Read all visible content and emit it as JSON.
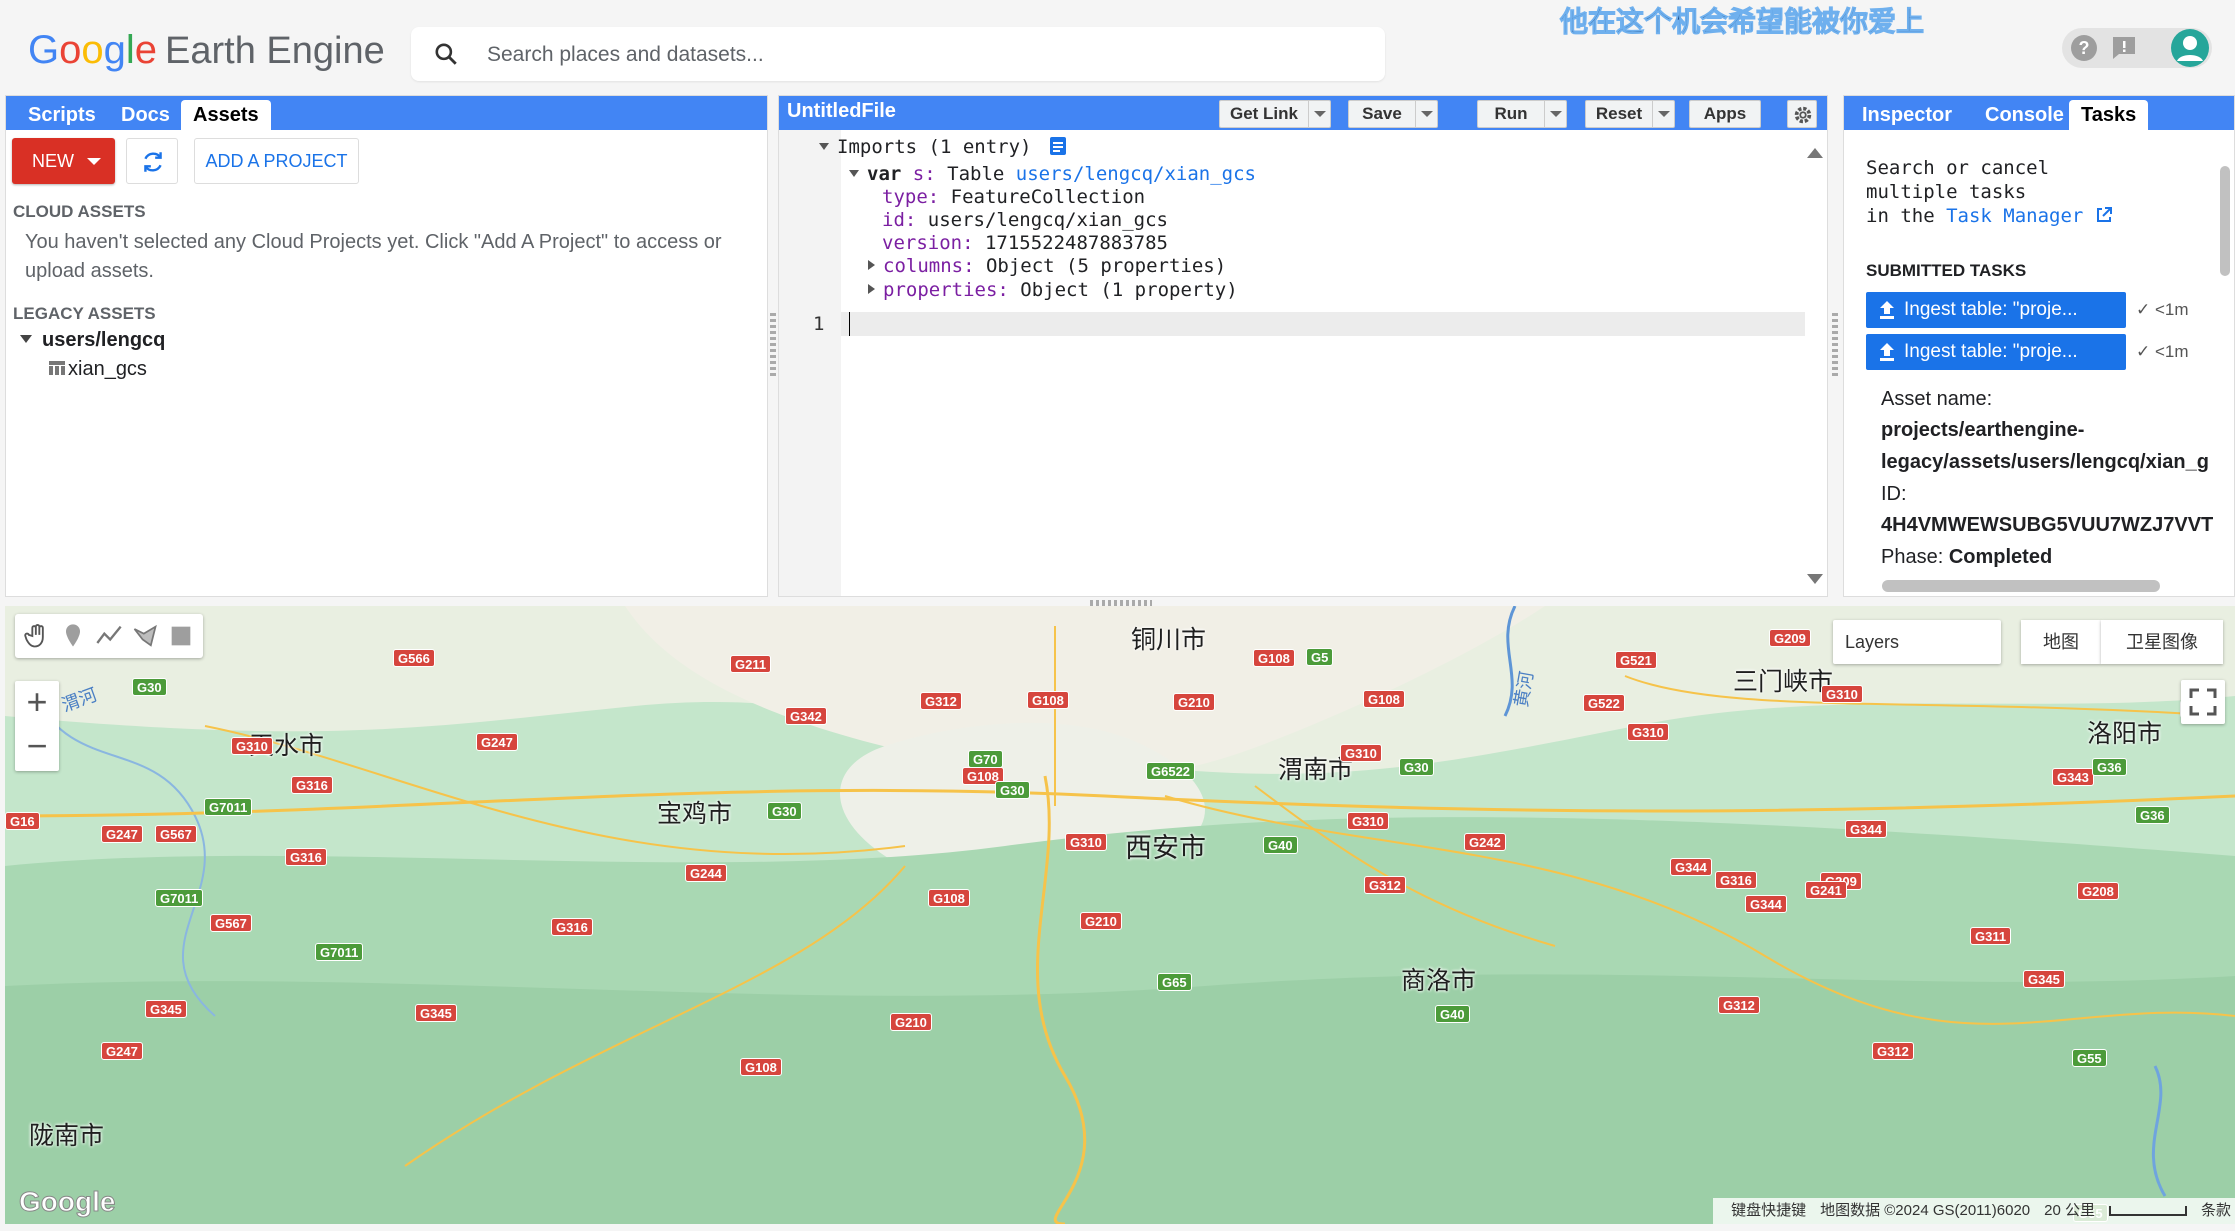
{
  "header": {
    "logo_google": [
      "G",
      "o",
      "o",
      "g",
      "l",
      "e"
    ],
    "logo_product": "Earth Engine",
    "search_placeholder": "Search places and datasets...",
    "overlay_text": "他在这个机会希望能被你爱上"
  },
  "left_panel": {
    "tabs": [
      "Scripts",
      "Docs",
      "Assets"
    ],
    "active_tab": "Assets",
    "new_label": "NEW",
    "add_project_label": "ADD A PROJECT",
    "cloud_assets_title": "CLOUD ASSETS",
    "cloud_assets_message": "You haven't selected any Cloud Projects yet. Click \"Add A Project\" to access or upload assets.",
    "legacy_assets_title": "LEGACY ASSETS",
    "tree_root": "users/lengcq",
    "tree_child": "xian_gcs"
  },
  "editor": {
    "file_title": "UntitledFile",
    "buttons": [
      "Get Link",
      "Save",
      "Run",
      "Reset",
      "Apps"
    ],
    "imports_label": "Imports (1 entry)",
    "var_kw": "var",
    "var_name": "s:",
    "var_type": "Table",
    "var_path": "users/lengcq/xian_gcs",
    "props": [
      {
        "key": "type:",
        "value": "FeatureCollection"
      },
      {
        "key": "id:",
        "value": "users/lengcq/xian_gcs"
      },
      {
        "key": "version:",
        "value": "1715522487883785"
      },
      {
        "key": "columns:",
        "value": "Object (5 properties)"
      },
      {
        "key": "properties:",
        "value": "Object (1 property)"
      }
    ],
    "line_number": "1"
  },
  "right_panel": {
    "tabs": [
      "Inspector",
      "Console",
      "Tasks"
    ],
    "active_tab": "Tasks",
    "intro_line1": "Search or cancel",
    "intro_line2": "multiple tasks",
    "intro_line3": "in the",
    "task_manager_link": "Task Manager",
    "submitted_title": "SUBMITTED TASKS",
    "tasks": [
      {
        "label": "Ingest table: \"proje...",
        "status": "<1m"
      },
      {
        "label": "Ingest table: \"proje...",
        "status": "<1m"
      }
    ],
    "asset_name_label": "Asset name:",
    "asset_name_line1": "projects/earthengine-",
    "asset_name_line2": "legacy/assets/users/lengcq/xian_g",
    "id_label": "ID:",
    "id_value": "4H4VMWEWSUBG5VUU7WZJ7VVT",
    "phase_label": "Phase:",
    "phase_value": "Completed"
  },
  "map": {
    "layers_label": "Layers",
    "map_types": [
      "地图",
      "卫星图像"
    ],
    "zoom_in": "+",
    "zoom_out": "−",
    "google_logo": "Google",
    "attribution": [
      "键盘快捷键",
      "地图数据 ©2024 GS(2011)6020",
      "20 公里",
      "条款"
    ],
    "cities": [
      {
        "name": "铜川市"
      },
      {
        "name": "天水市"
      },
      {
        "name": "渭南市"
      },
      {
        "name": "三门峡市"
      },
      {
        "name": "宝鸡市"
      },
      {
        "name": "西安市"
      },
      {
        "name": "洛阳市"
      },
      {
        "name": "商洛市"
      },
      {
        "name": "陇南市"
      }
    ],
    "rivers": [
      "渭河",
      "黄河"
    ],
    "shields_red": [
      "G566",
      "G211",
      "G108",
      "G209",
      "G521",
      "G342",
      "G312",
      "G108",
      "G210",
      "G108",
      "G522",
      "G310",
      "G310",
      "G310",
      "G247",
      "G310",
      "G108",
      "G343",
      "G316",
      "G310",
      "G310",
      "G344",
      "G247",
      "G567",
      "G316",
      "G244",
      "G108",
      "G312",
      "G242",
      "G344",
      "G209",
      "G241",
      "G208",
      "G567",
      "G316",
      "G210",
      "G311",
      "G345",
      "G345",
      "G210",
      "G312",
      "G345",
      "G247",
      "G108",
      "G312",
      "G344",
      "G316",
      "G16"
    ],
    "shields_green": [
      "G30",
      "G5",
      "G70",
      "G6522",
      "G30",
      "G36",
      "G30",
      "G30",
      "G40",
      "G36",
      "G7011",
      "G40",
      "G7011",
      "G7011",
      "G65",
      "G55",
      "G55",
      "G36"
    ]
  }
}
